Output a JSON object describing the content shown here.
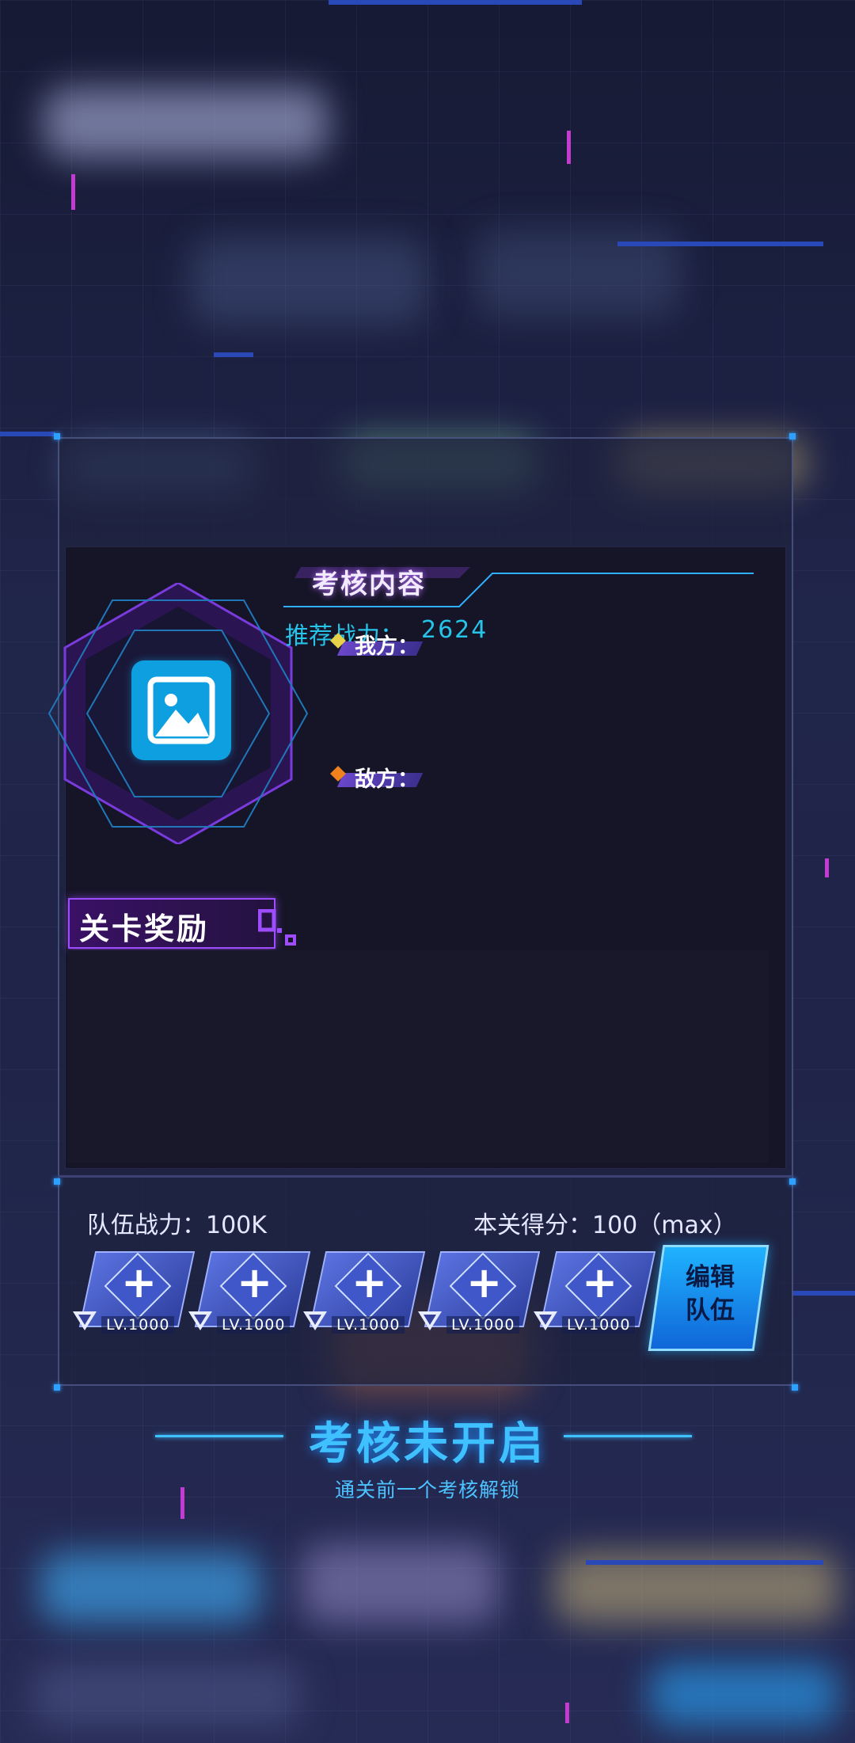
{
  "exam": {
    "title": "考核内容",
    "recommended_label": "推荐战力：",
    "recommended_value": "2624",
    "our_side": "我方：",
    "enemy_side": "敌方："
  },
  "rewards": {
    "label": "关卡奖励"
  },
  "team": {
    "power": "队伍战力：100K",
    "score": "本关得分：100（max）",
    "slots": [
      {
        "level": "LV.1000"
      },
      {
        "level": "LV.1000"
      },
      {
        "level": "LV.1000"
      },
      {
        "level": "LV.1000"
      },
      {
        "level": "LV.1000"
      }
    ],
    "edit_button": "编辑队伍"
  },
  "status": {
    "title": "考核未开启",
    "hint": "通关前一个考核解锁"
  },
  "colors": {
    "accent_blue": "#3fc0ff",
    "accent_purple": "#9e4cff",
    "recommend_cyan": "#25c4e8"
  },
  "icons": {
    "avatar": "image-placeholder-icon",
    "slot_add": "plus-icon",
    "slot_rank": "triangle-rank-icon"
  }
}
